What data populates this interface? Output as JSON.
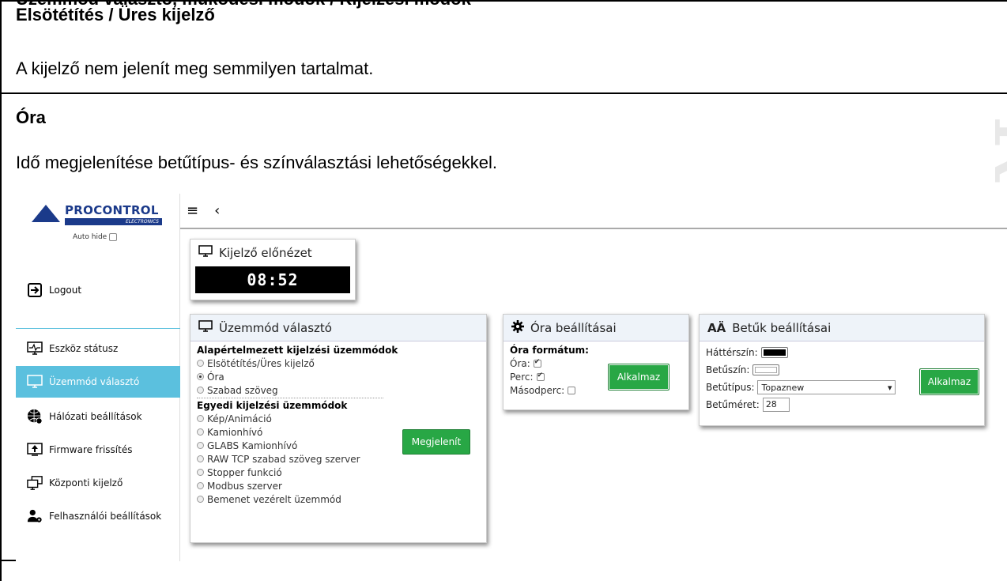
{
  "doc": {
    "cutoff_text": "Üzemmód választó, működési módok / Kijelzési módok",
    "section1_title": "Elsötétítés / Üres kijelző",
    "section1_text": "A kijelző nem jelenít meg semmilyen tartalmat.",
    "section2_title": "Óra",
    "section2_text": "Idő megjelenítése betűtípus- és színválasztási lehetőségekkel."
  },
  "app": {
    "logo": {
      "name": "PROCONTROL",
      "sub": "ELECTRONICS"
    },
    "autohide_label": "Auto hide",
    "logout_label": "Logout",
    "topbar": {
      "menu_icon": "≡",
      "back_icon": "‹"
    },
    "sidebar": {
      "items": [
        {
          "label": "Eszköz státusz",
          "icon": "monitor-pulse-icon"
        },
        {
          "label": "Üzemmód választó",
          "icon": "monitor-icon"
        },
        {
          "label": "Hálózati beállítások",
          "icon": "globe-gear-icon"
        },
        {
          "label": "Firmware frissítés",
          "icon": "upload-icon"
        },
        {
          "label": "Központi kijelző",
          "icon": "screens-icon"
        },
        {
          "label": "Felhasználói beállítások",
          "icon": "user-gear-icon"
        }
      ]
    },
    "preview": {
      "title": "Kijelző előnézet",
      "time": "08:52"
    },
    "mode_panel": {
      "title": "Üzemmód választó",
      "group1_title": "Alapértelmezett kijelzési üzemmódok",
      "group1": [
        "Elsötétítés/Üres kijelző",
        "Óra",
        "Szabad szöveg"
      ],
      "selected": "Óra",
      "group2_title": "Egyedi kijelzési üzemmódok",
      "group2": [
        "Kép/Animáció",
        "Kamionhívó",
        "GLABS Kamionhívó",
        "RAW TCP szabad szöveg szerver",
        "Stopper funkció",
        "Modbus szerver",
        "Bemenet vezérelt üzemmód"
      ],
      "button": "Megjelenít"
    },
    "clock_panel": {
      "title": "Óra beállításai",
      "format_label": "Óra formátum:",
      "hour_label": "Óra:",
      "minute_label": "Perc:",
      "second_label": "Másodperc:",
      "hour_checked": true,
      "minute_checked": true,
      "second_checked": false,
      "button": "Alkalmaz"
    },
    "font_panel": {
      "title": "Betűk beállításai",
      "bg_label": "Háttérszín:",
      "bg_color": "#000000",
      "fg_label": "Betűszín:",
      "fg_color": "#ffffff",
      "font_label": "Betűtípus:",
      "font_value": "Topaznew",
      "size_label": "Betűméret:",
      "size_value": "28",
      "button": "Alkalmaz"
    }
  }
}
